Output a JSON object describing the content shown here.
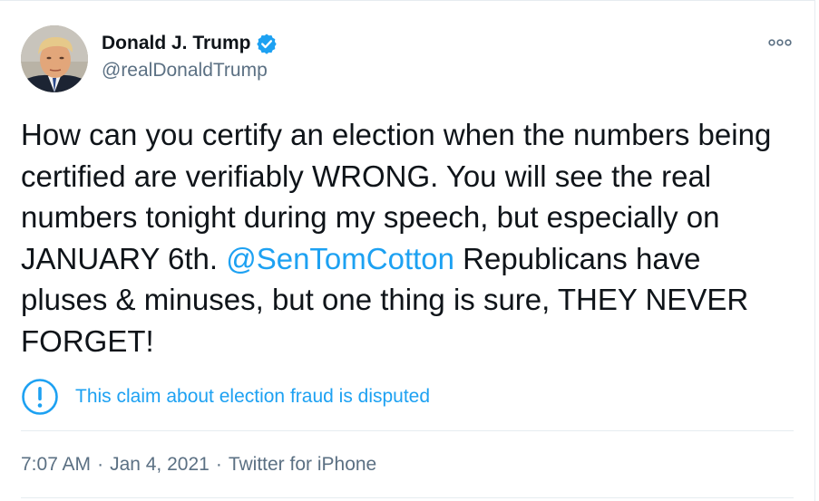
{
  "author": {
    "display_name": "Donald J. Trump",
    "handle": "@realDonaldTrump",
    "verified": true,
    "avatar_icon": "profile-photo"
  },
  "tweet": {
    "text_part1": "How can you certify an election when the numbers being certified are verifiably WRONG. You will see the real numbers tonight during my speech, but especially on JANUARY 6th. ",
    "mention": "@SenTomCotton",
    "text_part2": " Republicans have pluses & minuses, but one thing is sure, THEY NEVER FORGET!"
  },
  "notice": {
    "icon": "exclamation-circle-icon",
    "text": "This claim about election fraud is disputed"
  },
  "meta": {
    "time": "7:07 AM",
    "separator": "·",
    "date": "Jan 4, 2021",
    "source": "Twitter for iPhone"
  },
  "colors": {
    "accent": "#1da1f2",
    "secondary_text": "#5b7083",
    "primary_text": "#0f1419",
    "divider": "#e6ecf0"
  }
}
